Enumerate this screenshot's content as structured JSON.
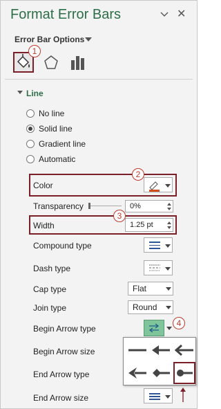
{
  "header": {
    "title": "Format Error Bars",
    "pin_icon": "chevron-down-icon",
    "close_icon": "close-icon",
    "close_glyph": "✕"
  },
  "options": {
    "label": "Error Bar Options"
  },
  "tabs": [
    {
      "name": "fill-line",
      "icon": "paint-bucket-icon"
    },
    {
      "name": "effects",
      "icon": "pentagon-icon"
    },
    {
      "name": "options",
      "icon": "bar-chart-icon"
    }
  ],
  "badges": {
    "b1": "1",
    "b2": "2",
    "b3": "3",
    "b4": "4"
  },
  "section": {
    "title": "Line"
  },
  "line_options": [
    {
      "label": "No line",
      "selected": false
    },
    {
      "label": "Solid line",
      "selected": true
    },
    {
      "label": "Gradient line",
      "selected": false
    },
    {
      "label": "Automatic",
      "selected": false
    }
  ],
  "props": {
    "color": "Color",
    "transparency": "Transparency",
    "transparency_value": "0%",
    "width": "Width",
    "width_value": "1.25 pt",
    "compound": "Compound type",
    "dash": "Dash type",
    "cap": "Cap type",
    "cap_value": "Flat",
    "join": "Join type",
    "join_value": "Round",
    "begin_arrow_type": "Begin Arrow type",
    "begin_arrow_size": "Begin Arrow size",
    "end_arrow_type": "End Arrow type",
    "end_arrow_size": "End Arrow size"
  },
  "colors": {
    "title_green": "#2c6e47",
    "highlight": "#7a1f28",
    "badge_red": "#c0392b",
    "line_color": "#d2501e",
    "arrow_btn": "#7fc49a"
  }
}
